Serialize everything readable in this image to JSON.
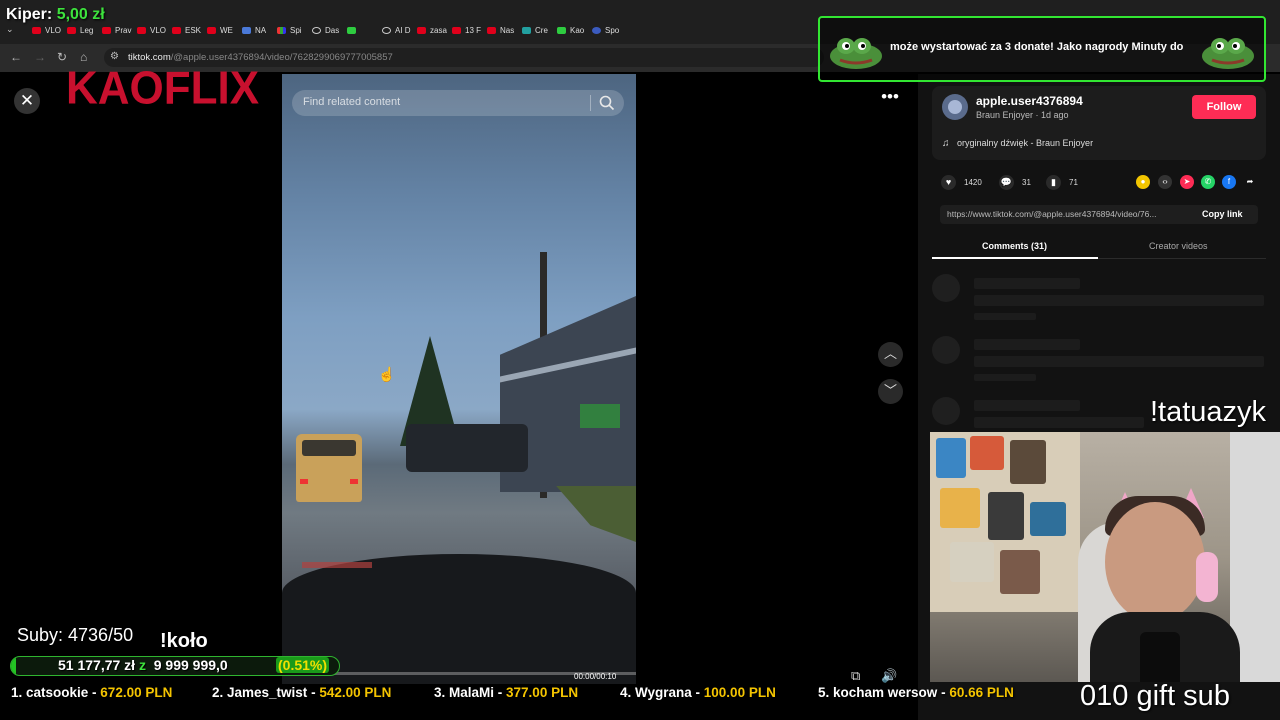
{
  "browser": {
    "tabs": [
      "VLO",
      "Leg",
      "Prav",
      "VLO",
      "ESK",
      "WE",
      "NA",
      "Spi",
      "Das",
      "",
      "AI D",
      "zasa",
      "13 F",
      "Nas",
      "Cre",
      "Kao",
      "Spo"
    ],
    "url_domain": "tiktok.com",
    "url_path": "/@apple.user4376894/video/7628299069777005857"
  },
  "overlay": {
    "kiper_label": "Kiper:",
    "kiper_amount": "5,00 zł",
    "kaoflix": "KAOFLIX",
    "donate_text": "może wystartować za 3 donate! Jako nagrody Minuty do",
    "tatuazyk": "!tatuazyk",
    "suby": "Suby: 4736/50",
    "kolo": "!koło",
    "goal_amount": "51 177,77 zł",
    "goal_sep": "z",
    "goal_target": "9 999 999,0",
    "goal_pct": "(0.51%)",
    "goal_fraction": 0.0051,
    "gift_sub": "010 gift sub",
    "ticker": [
      {
        "name": "1. catsookie",
        "amount": "672.00 PLN"
      },
      {
        "name": "2. James_twist",
        "amount": "542.00 PLN"
      },
      {
        "name": "3. MalaMi",
        "amount": "377.00 PLN"
      },
      {
        "name": "4. Wygrana",
        "amount": "100.00 PLN"
      },
      {
        "name": "5. kocham wersow",
        "amount": "60.66 PLN"
      }
    ],
    "accent_green": "#32e632",
    "accent_gold": "#f4c400",
    "brand_red": "#c8102e"
  },
  "tiktok": {
    "search_placeholder": "Find related content",
    "time": "00:00/00:10",
    "username": "apple.user4376894",
    "subline": "Braun Enjoyer · 1d ago",
    "follow": "Follow",
    "music": "oryginalny dźwięk - Braun Enjoyer",
    "likes": "1420",
    "comments": "31",
    "saves": "71",
    "link": "https://www.tiktok.com/@apple.user4376894/video/76...",
    "copy_link": "Copy link",
    "tab_comments": "Comments (31)",
    "tab_creator": "Creator videos",
    "follow_color": "#fe2c55"
  }
}
